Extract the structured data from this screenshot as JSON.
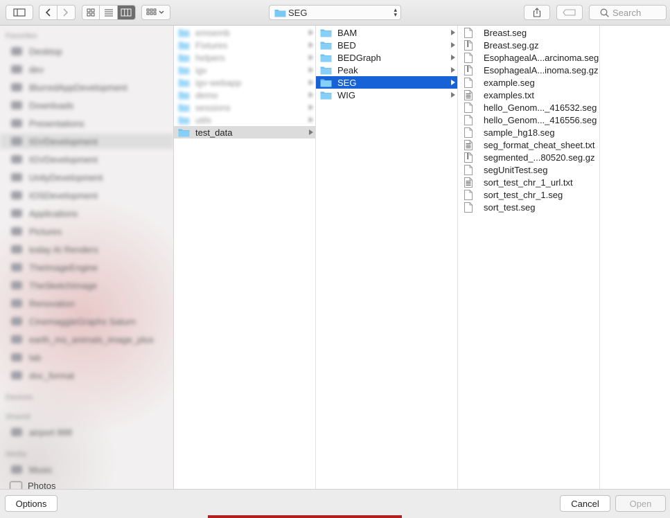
{
  "toolbar": {
    "path_label": "SEG",
    "search_placeholder": "Search"
  },
  "sidebar": {
    "items": [
      {
        "label": "Favorites",
        "type": "header"
      },
      {
        "label": "Desktop"
      },
      {
        "label": "dev"
      },
      {
        "label": "BlurredAppDevelopment"
      },
      {
        "label": "Downloads"
      },
      {
        "label": "Presentations"
      },
      {
        "label": "IGVDevelopment",
        "selected": true
      },
      {
        "label": "IGVDevelopment"
      },
      {
        "label": "UnityDevelopment"
      },
      {
        "label": "IOSDevelopment"
      },
      {
        "label": "Applications"
      },
      {
        "label": "Pictures"
      },
      {
        "label": "today AI Renders"
      },
      {
        "label": "TheImageEngine"
      },
      {
        "label": "TheSketchImage"
      },
      {
        "label": "Renovation"
      },
      {
        "label": "CinemaggieGraphs Saturn"
      },
      {
        "label": "earth_ms_animals_image_plus"
      },
      {
        "label": "lab"
      },
      {
        "label": "doc_format"
      },
      {
        "label": "Devices",
        "type": "header"
      },
      {
        "label": "Shared",
        "type": "header"
      },
      {
        "label": "airport 888",
        "type": "host"
      },
      {
        "label": "Media",
        "type": "header"
      },
      {
        "label": "Music"
      }
    ],
    "photos_label": "Photos"
  },
  "column1": {
    "items": [
      {
        "label": "emsemb",
        "blurred": true
      },
      {
        "label": "Fixtures",
        "blurred": true
      },
      {
        "label": "helpers",
        "blurred": true
      },
      {
        "label": "igv",
        "blurred": true
      },
      {
        "label": "igv-webapp",
        "blurred": true
      },
      {
        "label": "demo",
        "blurred": true
      },
      {
        "label": "sessions",
        "blurred": true
      },
      {
        "label": "utils",
        "blurred": true
      },
      {
        "label": "test_data",
        "selected_inactive": true
      }
    ]
  },
  "column2": {
    "items": [
      {
        "label": "BAM"
      },
      {
        "label": "BED"
      },
      {
        "label": "BEDGraph"
      },
      {
        "label": "Peak"
      },
      {
        "label": "SEG",
        "selected": true
      },
      {
        "label": "WIG"
      }
    ]
  },
  "column3": {
    "files": [
      {
        "label": "Breast.seg",
        "icon": "doc"
      },
      {
        "label": "Breast.seg.gz",
        "icon": "archive"
      },
      {
        "label": "EsophagealA...arcinoma.seg",
        "icon": "doc"
      },
      {
        "label": "EsophagealA...inoma.seg.gz",
        "icon": "archive"
      },
      {
        "label": "example.seg",
        "icon": "doc"
      },
      {
        "label": "examples.txt",
        "icon": "text"
      },
      {
        "label": "hello_Genom..._416532.seg",
        "icon": "doc"
      },
      {
        "label": "hello_Genom..._416556.seg",
        "icon": "doc"
      },
      {
        "label": "sample_hg18.seg",
        "icon": "doc"
      },
      {
        "label": "seg_format_cheat_sheet.txt",
        "icon": "text"
      },
      {
        "label": "segmented_...80520.seg.gz",
        "icon": "archive"
      },
      {
        "label": "segUnitTest.seg",
        "icon": "doc"
      },
      {
        "label": "sort_test_chr_1_url.txt",
        "icon": "text"
      },
      {
        "label": "sort_test_chr_1.seg",
        "icon": "doc"
      },
      {
        "label": "sort_test.seg",
        "icon": "doc"
      }
    ]
  },
  "bottom": {
    "options_label": "Options",
    "cancel_label": "Cancel",
    "open_label": "Open"
  },
  "colors": {
    "selection": "#1762d6",
    "folder": "#6cc0f2"
  }
}
